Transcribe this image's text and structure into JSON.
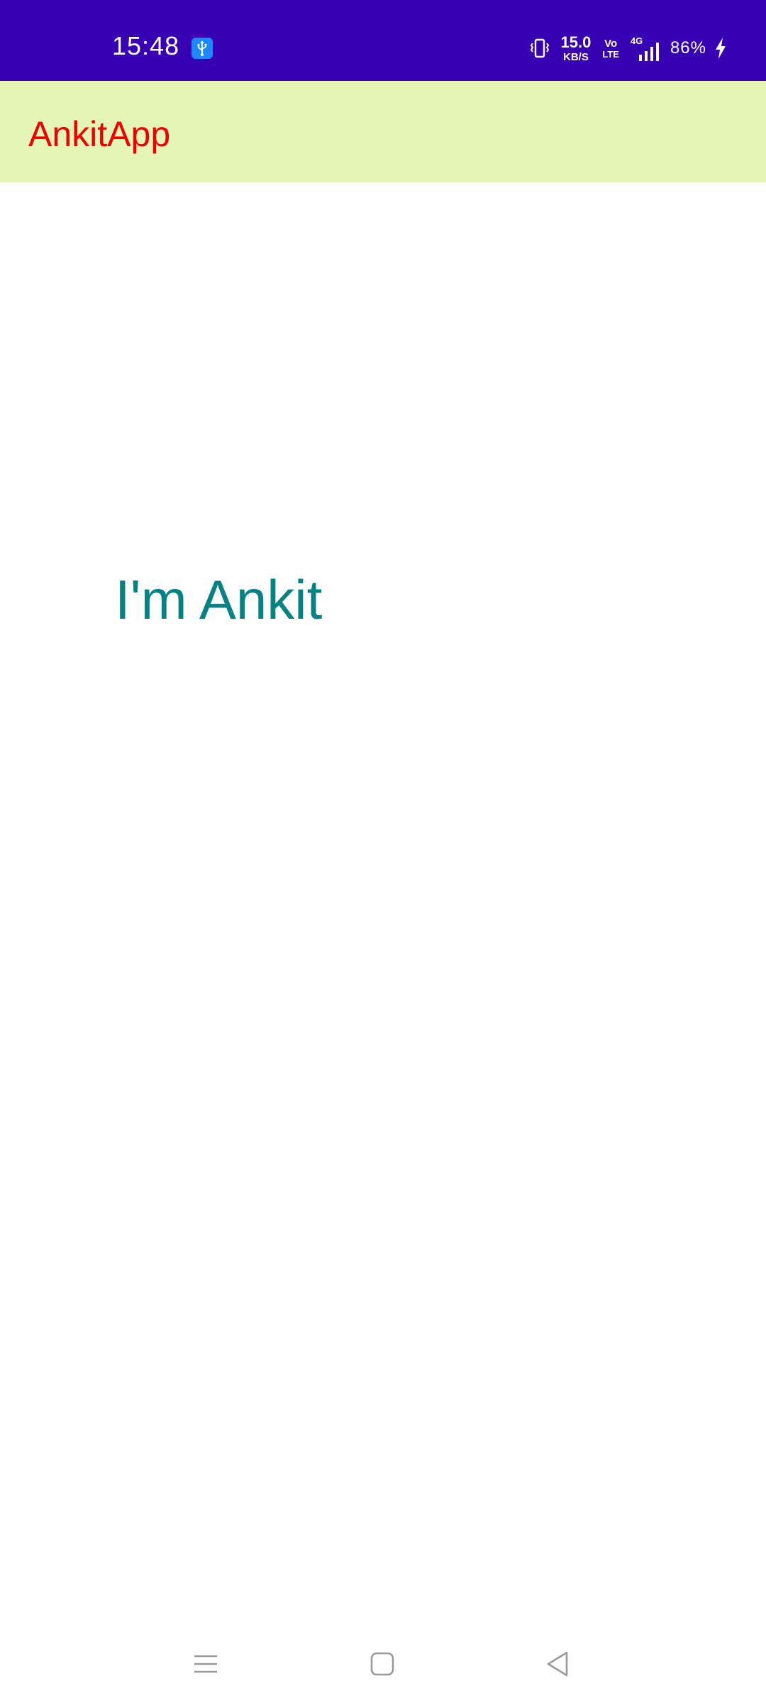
{
  "status_bar": {
    "time": "15:48",
    "icons": {
      "usb": "usb-icon",
      "vibrate": "vibrate-icon",
      "signal": "signal-icon",
      "charging": "charging-icon"
    },
    "net_speed_value": "15.0",
    "net_speed_unit": "KB/S",
    "volte_top": "Vo",
    "volte_bottom": "LTE",
    "network_type": "4G",
    "battery": "86%",
    "colors": {
      "background": "#3700b3",
      "usb_badge": "#1e88ff"
    }
  },
  "app_bar": {
    "title": "AnkitApp",
    "colors": {
      "background": "#e4f5b6",
      "title": "#ee0000"
    }
  },
  "content": {
    "greeting": "I'm Ankit",
    "colors": {
      "greeting": "#078282"
    }
  },
  "nav_bar": {
    "icons": {
      "recents": "recents-icon",
      "home": "home-icon",
      "back": "back-icon"
    }
  }
}
